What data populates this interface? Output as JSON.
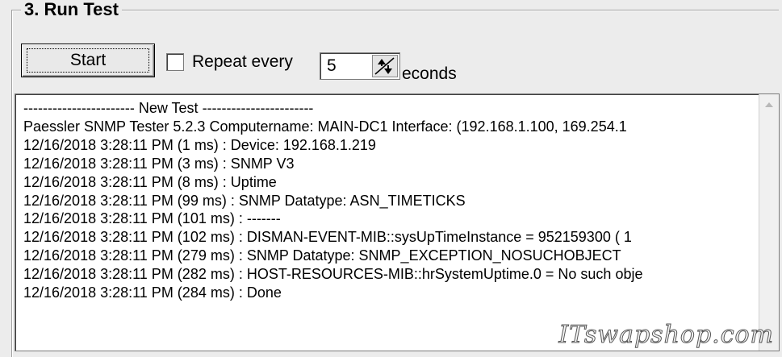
{
  "group": {
    "title": "3. Run Test"
  },
  "controls": {
    "start_label": "Start",
    "repeat_label": "Repeat every",
    "repeat_checked": false,
    "interval_value": "5",
    "seconds_label": "econds"
  },
  "log": {
    "lines": [
      "----------------------- New Test -----------------------",
      "Paessler SNMP Tester 5.2.3 Computername: MAIN-DC1 Interface: (192.168.1.100, 169.254.1",
      "12/16/2018 3:28:11 PM (1 ms) : Device: 192.168.1.219",
      "12/16/2018 3:28:11 PM (3 ms) : SNMP V3",
      "12/16/2018 3:28:11 PM (8 ms) : Uptime",
      "12/16/2018 3:28:11 PM (99 ms) : SNMP Datatype: ASN_TIMETICKS",
      "12/16/2018 3:28:11 PM (101 ms) : -------",
      "12/16/2018 3:28:11 PM (102 ms) : DISMAN-EVENT-MIB::sysUpTimeInstance = 952159300 ( 1",
      "12/16/2018 3:28:11 PM (279 ms) : SNMP Datatype: SNMP_EXCEPTION_NOSUCHOBJECT",
      "12/16/2018 3:28:11 PM (282 ms) : HOST-RESOURCES-MIB::hrSystemUptime.0 = No such obje",
      "12/16/2018 3:28:11 PM (284 ms) : Done"
    ]
  },
  "watermark": "ITswapshop.com"
}
